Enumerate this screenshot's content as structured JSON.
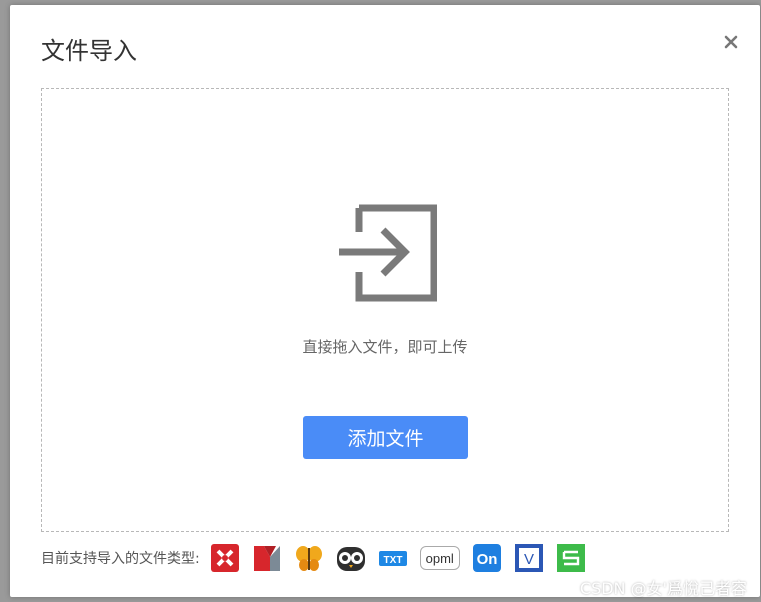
{
  "dialog": {
    "title": "文件导入",
    "close_icon": "close-icon"
  },
  "dropzone": {
    "icon": "import-icon",
    "hint": "直接拖入文件，即可上传",
    "add_button": "添加文件"
  },
  "supported": {
    "label": "目前支持导入的文件类型:",
    "types": [
      {
        "icon": "xmind-icon"
      },
      {
        "icon": "mindmanager-icon"
      },
      {
        "icon": "freemind-icon"
      },
      {
        "icon": "owl-icon"
      },
      {
        "icon": "txt-icon",
        "text": "TXT"
      },
      {
        "icon": "opml-icon",
        "text": "opml"
      },
      {
        "icon": "onenote-icon",
        "text": "On"
      },
      {
        "icon": "visio-icon",
        "text": "V"
      },
      {
        "icon": "sheet-icon"
      }
    ]
  },
  "watermark": "CSDN @女'爲悅己者容",
  "colors": {
    "primary": "#4a8cf7",
    "icon_gray": "#7a7a7a",
    "overlay": "#9a9a9a"
  }
}
